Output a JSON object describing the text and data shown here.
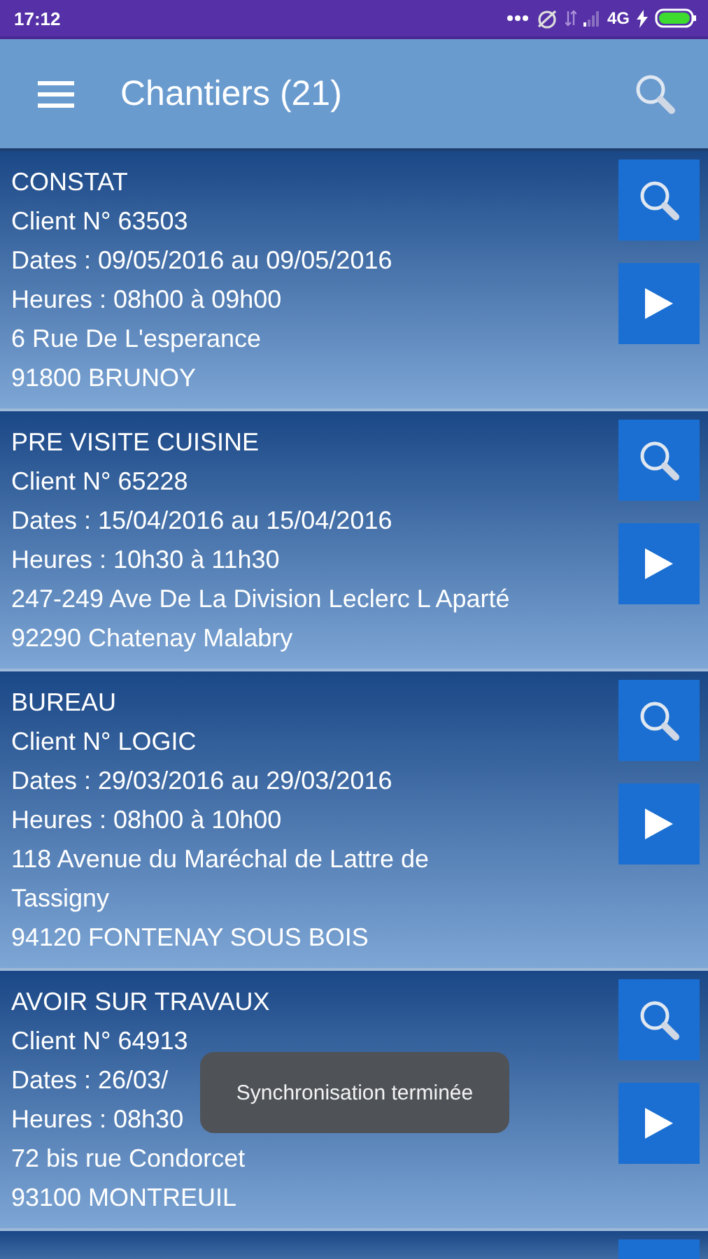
{
  "status_bar": {
    "time": "17:12",
    "network": "4G"
  },
  "app_bar": {
    "title": "Chantiers (21)"
  },
  "chantiers": [
    {
      "title": "CONSTAT",
      "client": "Client N° 63503",
      "dates": "Dates : 09/05/2016 au 09/05/2016",
      "heures": "Heures : 08h00 à 09h00",
      "address": [
        "6 Rue De L'esperance",
        "91800 BRUNOY"
      ]
    },
    {
      "title": "PRE VISITE CUISINE",
      "client": "Client N° 65228",
      "dates": "Dates : 15/04/2016 au 15/04/2016",
      "heures": "Heures : 10h30 à 11h30",
      "address": [
        "247-249 Ave De La Division Leclerc L Aparté",
        "92290 Chatenay Malabry"
      ]
    },
    {
      "title": "BUREAU",
      "client": "Client N° LOGIC",
      "dates": "Dates : 29/03/2016 au 29/03/2016",
      "heures": "Heures : 08h00 à 10h00",
      "address": [
        "118 Avenue du Maréchal de Lattre de Tassigny",
        "94120 FONTENAY SOUS BOIS"
      ]
    },
    {
      "title": "AVOIR SUR TRAVAUX",
      "client": "Client N° 64913",
      "dates": "Dates : 26/03/",
      "heures": "Heures : 08h30",
      "address": [
        "72 bis rue Condorcet",
        "93100 MONTREUIL"
      ]
    }
  ],
  "toast": {
    "text": "Synchronisation terminée"
  }
}
